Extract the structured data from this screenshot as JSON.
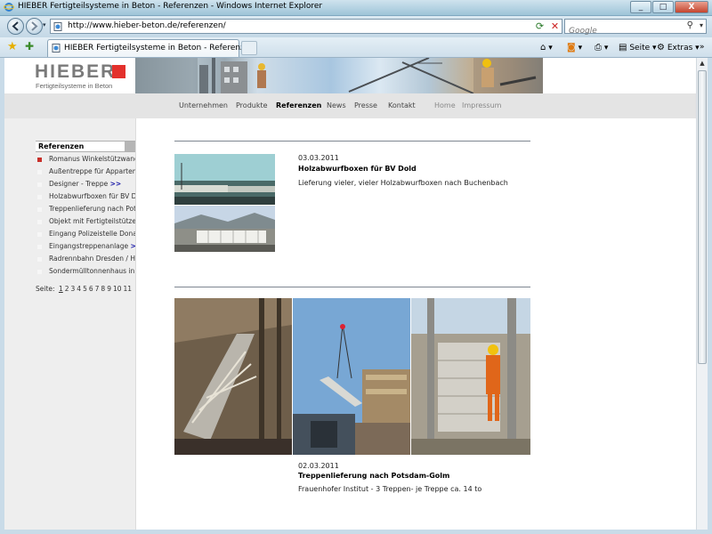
{
  "window": {
    "title": "HIEBER Fertigteilsysteme in Beton - Referenzen - Windows Internet Explorer",
    "controls": [
      "_",
      "□",
      "X"
    ]
  },
  "addressbar": {
    "url": "http://www.hieber-beton.de/referenzen/",
    "search_placeholder": "Google"
  },
  "tabs": [
    {
      "label": "HIEBER Fertigteilsysteme in Beton - Referenzen"
    }
  ],
  "commandbar": {
    "page_label": "Seite",
    "extras_label": "Extras"
  },
  "site": {
    "logo_name": "HIEBER",
    "logo_tagline": "Fertigteilsysteme in Beton",
    "nav": [
      {
        "label": "Unternehmen",
        "active": false
      },
      {
        "label": "Produkte",
        "active": false
      },
      {
        "label": "Referenzen",
        "active": true
      },
      {
        "label": "News",
        "active": false
      },
      {
        "label": "Presse",
        "active": false
      },
      {
        "label": "Kontakt",
        "active": false
      }
    ],
    "nav_secondary": [
      {
        "label": "Home"
      },
      {
        "label": "Impressum"
      }
    ]
  },
  "sidebar": {
    "heading": "Referenzen",
    "items": [
      {
        "label": "Romanus Winkelstützwand",
        "active": true,
        "arrow": ""
      },
      {
        "label": "Außentreppe für Appartem",
        "active": false,
        "arrow": ""
      },
      {
        "label": "Designer - Treppe",
        "active": false,
        "arrow": ">>"
      },
      {
        "label": "Holzabwurfboxen für BV Do",
        "active": false,
        "arrow": ""
      },
      {
        "label": "Treppenlieferung nach Pot",
        "active": false,
        "arrow": ""
      },
      {
        "label": "Objekt mit Fertigteilstützen",
        "active": false,
        "arrow": ""
      },
      {
        "label": "Eingang Polizeistelle Dona",
        "active": false,
        "arrow": ""
      },
      {
        "label": "Eingangstreppenanlage",
        "active": false,
        "arrow": ">>"
      },
      {
        "label": "Radrennbahn Dresden / H",
        "active": false,
        "arrow": ""
      },
      {
        "label": "Sondermülltonnenhaus in",
        "active": false,
        "arrow": ""
      }
    ],
    "pager_label": "Seite:",
    "pages": [
      "1",
      "2",
      "3",
      "4",
      "5",
      "6",
      "7",
      "8",
      "9",
      "10",
      "11"
    ]
  },
  "news": [
    {
      "date": "03.03.2011",
      "title": "Holzabwurfboxen für BV Dold",
      "text": "Lieferung vieler, vieler Holzabwurfboxen nach Buchenbach"
    },
    {
      "date": "02.03.2011",
      "title": "Treppenlieferung nach Potsdam-Golm",
      "text": "Frauenhofer Institut - 3 Treppen- je Treppe ca. 14 to"
    }
  ]
}
